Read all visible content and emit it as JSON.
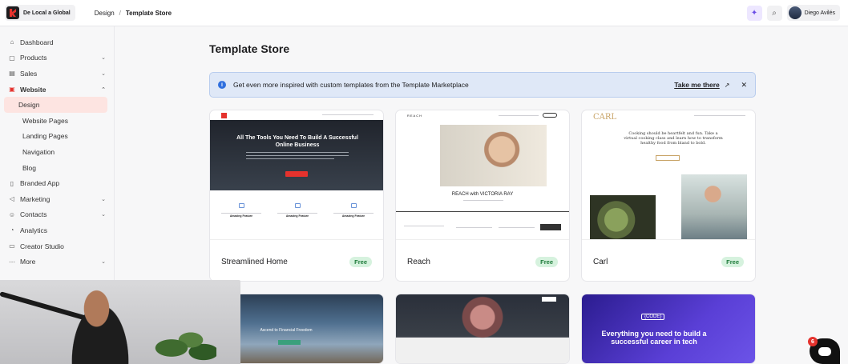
{
  "topbar": {
    "brand_name": "De Local a Global",
    "breadcrumb": [
      "Design",
      "Template Store"
    ],
    "breadcrumb_sep": "/",
    "user_name": "Diego Avilés"
  },
  "sidebar": {
    "items": [
      {
        "label": "Dashboard",
        "icon": "home-icon"
      },
      {
        "label": "Products",
        "icon": "box-icon",
        "expandable": true
      },
      {
        "label": "Sales",
        "icon": "cart-icon",
        "expandable": true
      },
      {
        "label": "Website",
        "icon": "browser-icon",
        "expanded": true,
        "active": true
      },
      {
        "label": "Branded App",
        "icon": "phone-icon"
      },
      {
        "label": "Marketing",
        "icon": "megaphone-icon",
        "expandable": true
      },
      {
        "label": "Contacts",
        "icon": "contacts-icon",
        "expandable": true
      },
      {
        "label": "Analytics",
        "icon": "chart-icon"
      },
      {
        "label": "Creator Studio",
        "icon": "studio-icon"
      },
      {
        "label": "More",
        "icon": "dots-icon",
        "expandable": true
      }
    ],
    "website_sub": [
      "Design",
      "Website Pages",
      "Landing Pages",
      "Navigation",
      "Blog"
    ],
    "selected_sub": "Design"
  },
  "main": {
    "title": "Template Store",
    "banner": {
      "text": "Get even more inspired with custom templates from the Template Marketplace",
      "link": "Take me there"
    },
    "templates": [
      {
        "name": "Streamlined Home",
        "badge": "Free",
        "preview_headline": "All The Tools You Need To Build A Successful Online Business",
        "feature_label": "Amazing Feature"
      },
      {
        "name": "Reach",
        "badge": "Free",
        "preview_logo": "REACH",
        "preview_headline": "REACH with VICTORIA RAY"
      },
      {
        "name": "Carl",
        "badge": "Free",
        "preview_logo": "CARL",
        "preview_text": "Cooking should be heartfelt and fun. Take a virtual cooking class and learn how to transform healthy food from bland to bold."
      }
    ],
    "row2": [
      {
        "preview_text": "Ascend to Financial Freedom"
      },
      {
        "preview_text": ""
      },
      {
        "preview_tag": "{CODE}",
        "preview_text": "Everything you need to build a successful career in tech"
      }
    ]
  },
  "chat": {
    "badge_count": "6"
  },
  "colors": {
    "brand_red": "#e5322d",
    "free_badge": "#d6f2de",
    "banner_bg": "#dfe8f7"
  }
}
